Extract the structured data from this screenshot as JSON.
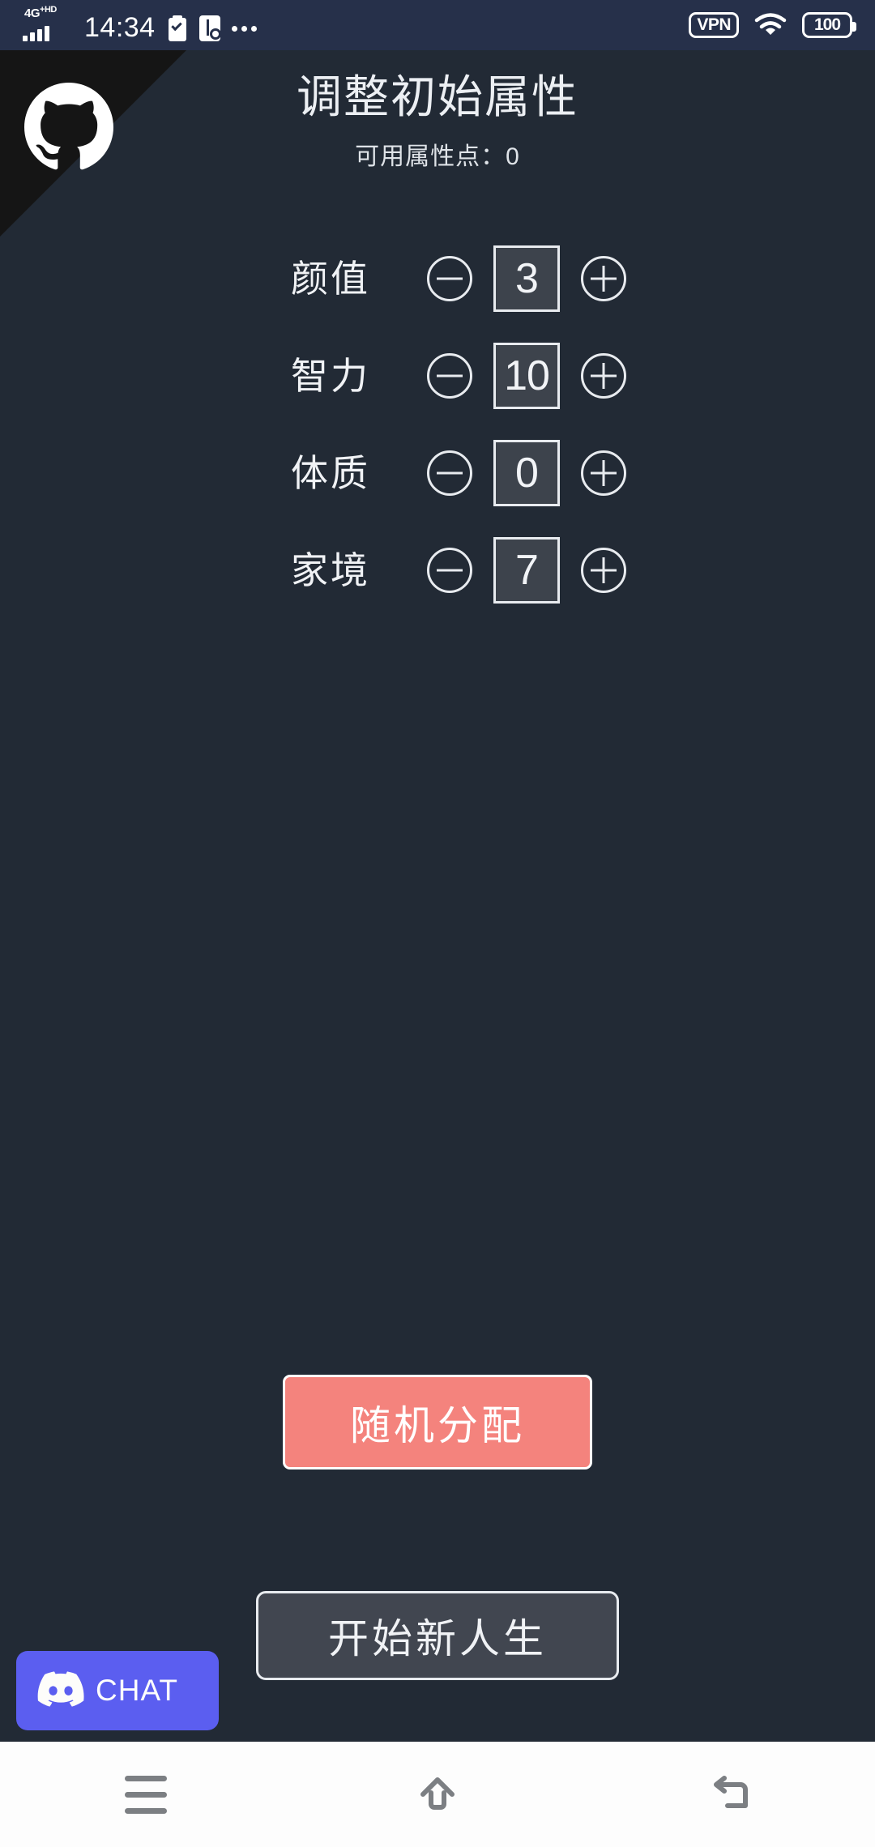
{
  "status_bar": {
    "network_label": "4G",
    "network_sup": "+HD",
    "time": "14:34",
    "icons": [
      "signal-icon",
      "clipboard-check-icon",
      "usb-debug-icon",
      "more-dots-icon"
    ],
    "vpn_label": "VPN",
    "wifi_icon": "wifi-icon",
    "battery_level": "100",
    "background_color": "#26304a"
  },
  "corner_ribbon": {
    "icon": "github-octocat-icon",
    "background_color": "#151515"
  },
  "header": {
    "title": "调整初始属性",
    "subtitle": "可用属性点：0",
    "available_points": 0
  },
  "attributes": [
    {
      "label": "颜值",
      "value": "3",
      "minus_icon": "minus-circle-icon",
      "plus_icon": "plus-circle-icon"
    },
    {
      "label": "智力",
      "value": "10",
      "minus_icon": "minus-circle-icon",
      "plus_icon": "plus-circle-icon"
    },
    {
      "label": "体质",
      "value": "0",
      "minus_icon": "minus-circle-icon",
      "plus_icon": "plus-circle-icon"
    },
    {
      "label": "家境",
      "value": "7",
      "minus_icon": "minus-circle-icon",
      "plus_icon": "plus-circle-icon"
    }
  ],
  "buttons": {
    "random_label": "随机分配",
    "random_color": "#f4837d",
    "start_label": "开始新人生",
    "start_color": "#414650"
  },
  "discord_widget": {
    "label": "CHAT",
    "icon": "discord-logo-icon",
    "background_color": "#5b5ef0"
  },
  "nav_bar": {
    "recents_icon": "recents-menu-icon",
    "home_icon": "home-arrow-icon",
    "back_icon": "back-return-icon",
    "background_color": "#fdfdfd"
  },
  "theme": {
    "page_background": "#222a35",
    "text_primary": "#f0f2f5",
    "value_box_fill": "#3d434c"
  }
}
